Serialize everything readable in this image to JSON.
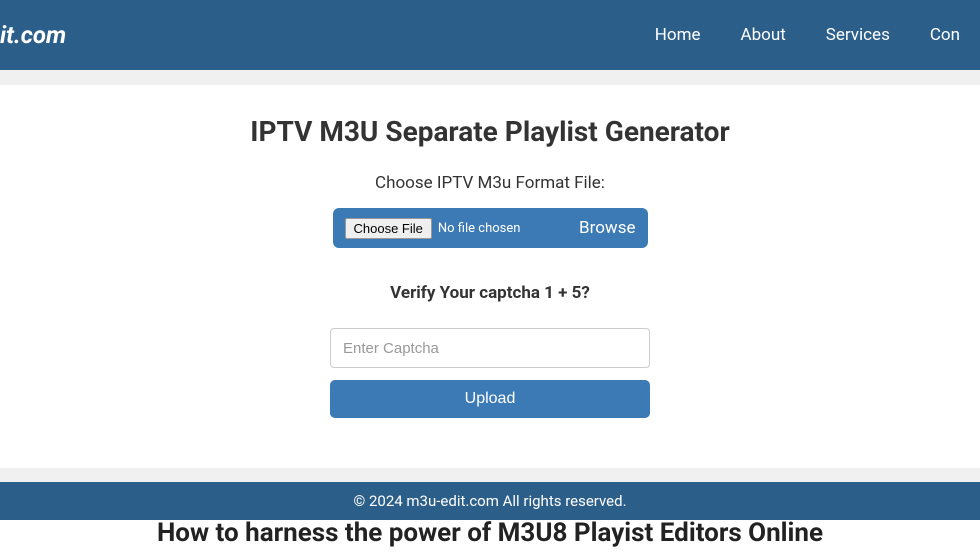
{
  "header": {
    "logo": "it.com",
    "nav": {
      "home": "Home",
      "about": "About",
      "services": "Services",
      "contact": "Con"
    }
  },
  "main": {
    "title": "IPTV M3U Separate Playlist Generator",
    "choose_label": "Choose IPTV M3u Format File:",
    "choose_file_btn": "Choose File",
    "no_file_text": "No file chosen",
    "browse_text": "Browse",
    "captcha_label": "Verify Your captcha 1 + 5?",
    "captcha_placeholder": "Enter Captcha",
    "upload_btn": "Upload"
  },
  "section2": {
    "title": "How to harness the power of M3U8 Playist Editors Online"
  },
  "footer": {
    "text": "© 2024 m3u-edit.com All rights reserved."
  }
}
